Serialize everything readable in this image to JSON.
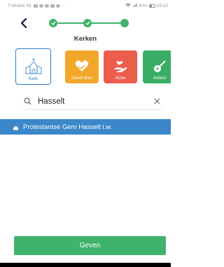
{
  "status_bar": {
    "carrier": "T-Mobile NL",
    "battery": "30%",
    "time": "19:15"
  },
  "stepper": {
    "steps_total": 3,
    "active_color": "#3fb36b"
  },
  "page": {
    "title": "Kerken"
  },
  "categories": [
    {
      "label": "Kerk",
      "icon": "church-icon",
      "selected": true,
      "color": "#2b7cc2"
    },
    {
      "label": "Goed doel",
      "icon": "handshake-heart-icon",
      "selected": false,
      "color": "#f2a72a"
    },
    {
      "label": "Actie",
      "icon": "hand-heart-icon",
      "selected": false,
      "color": "#ec5d4b"
    },
    {
      "label": "Artiest",
      "icon": "guitar-icon",
      "selected": false,
      "color": "#39ad66"
    }
  ],
  "search": {
    "value": "Hasselt",
    "icon": "search-icon",
    "clear_icon": "close-icon"
  },
  "results": [
    {
      "label": "Protestantse Gem Hasselt i.w.",
      "icon": "church-icon",
      "selected": true
    }
  ],
  "actions": {
    "primary_label": "Geven"
  },
  "colors": {
    "accent_blue": "#2b7cc2",
    "selection_blue": "#3b87c9",
    "green": "#3fb36b",
    "orange": "#f2a72a",
    "red": "#ec5d4b"
  }
}
